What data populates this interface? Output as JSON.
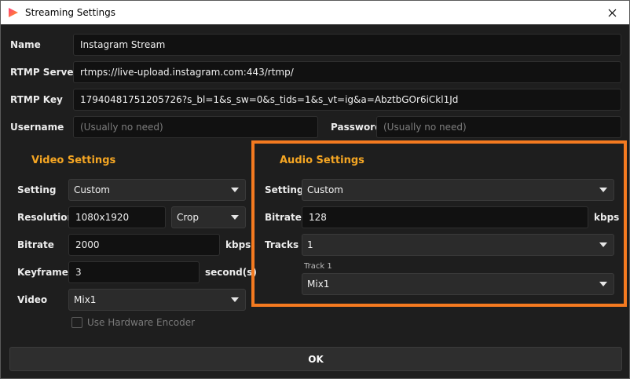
{
  "window": {
    "title": "Streaming Settings"
  },
  "stream": {
    "name_label": "Name",
    "name_value": "Instagram Stream",
    "rtmp_server_label": "RTMP Server",
    "rtmp_server_value": "rtmps://live-upload.instagram.com:443/rtmp/",
    "rtmp_key_label": "RTMP Key",
    "rtmp_key_value": "17940481751205726?s_bl=1&s_sw=0&s_tids=1&s_vt=ig&a=AbztbGOr6iCkl1Jd",
    "username_label": "Username",
    "username_placeholder": "(Usually no need)",
    "password_label": "Password",
    "password_placeholder": "(Usually no need)"
  },
  "video": {
    "section_title": "Video Settings",
    "setting_label": "Setting",
    "setting_value": "Custom",
    "resolution_label": "Resolution",
    "resolution_value": "1080x1920",
    "resolution_mode": "Crop",
    "bitrate_label": "Bitrate",
    "bitrate_value": "2000",
    "bitrate_unit": "kbps",
    "keyframe_label": "Keyframe",
    "keyframe_value": "3",
    "keyframe_unit": "second(s)",
    "video_label": "Video",
    "video_value": "Mix1",
    "hw_encoder_label": "Use Hardware Encoder"
  },
  "audio": {
    "section_title": "Audio Settings",
    "setting_label": "Setting",
    "setting_value": "Custom",
    "bitrate_label": "Bitrate",
    "bitrate_value": "128",
    "bitrate_unit": "kbps",
    "tracks_label": "Tracks",
    "tracks_value": "1",
    "track1_label": "Track 1",
    "track1_value": "Mix1"
  },
  "footer": {
    "ok_label": "OK"
  },
  "colors": {
    "accent": "#f5a623",
    "highlight": "#f47a20"
  }
}
